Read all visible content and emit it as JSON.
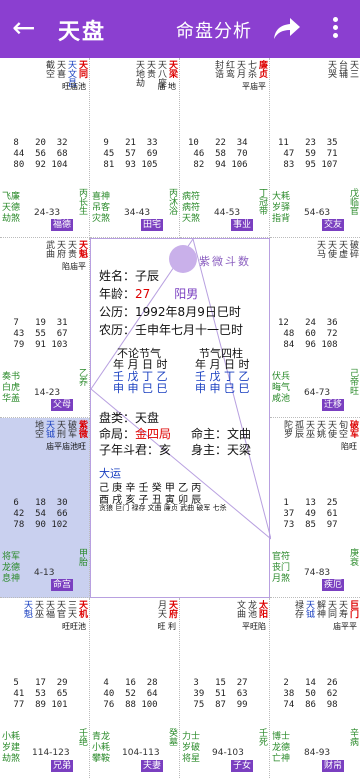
{
  "app": {
    "back": "←",
    "title": "天盘",
    "subtitle": "命盘分析"
  },
  "palaces": [
    {
      "stars": [
        "天同",
        "天文昌",
        "天喜",
        "截空"
      ],
      "main": "天同",
      "bright": "旺庙池",
      "nums": " 8   20  32\n 44  56  68\n 80  92 104",
      "l1": [
        "飞廉",
        "天德",
        "劫煞"
      ],
      "l2": [],
      "ages": "24-33",
      "gz": "丙长生",
      "palace": "福德"
    },
    {
      "stars": [
        "天梁",
        "天八座",
        "天贵",
        "天地劫"
      ],
      "main": "天梁",
      "bright": "庙 地",
      "nums": " 9   21  33\n 45  57  69\n 81  93 105",
      "l1": [
        "喜神",
        "吊客",
        "灾煞"
      ],
      "l2": [],
      "ages": "34-43",
      "gz": "丙沐浴",
      "palace": "田宅"
    },
    {
      "stars": [
        "廉贞",
        "七杀",
        "天月",
        "红鸾",
        "封诰"
      ],
      "main": "七杀",
      "bright": "平庙平",
      "nums": "10   22  34\n 46  58  70\n 82  94 106",
      "l1": [
        "病符",
        "病符",
        "天煞"
      ],
      "l2": [],
      "ages": "44-53",
      "gz": "丁冠带",
      "palace": "事业"
    },
    {
      "stars": [
        "天三",
        "台辅",
        "天哭"
      ],
      "main": "",
      "bright": "",
      "nums": "11   23  35\n 47  59  71\n 83  95 107",
      "l1": [
        "大耗",
        "岁驿",
        "指背"
      ],
      "l2": [],
      "ages": "54-63",
      "gz": "戊临官",
      "palace": "交友"
    }
  ],
  "left_mid": [
    {
      "stars": [
        "天魁",
        "天贵",
        "天府",
        "武曲"
      ],
      "bright": "陷庙平",
      "nums": " 7   19  31\n 43  55  67\n 79  91 103",
      "l1": [
        "奏书",
        "白虎",
        "华盖"
      ],
      "ages": "14-23",
      "gz": "乙养",
      "palace": "父母"
    },
    {
      "stars": [
        "破军",
        "天刑",
        "天钺",
        "地空",
        "紫微"
      ],
      "bright": "庙平庙池旺",
      "nums": " 6   18  30\n 42  54  66\n 78  90 102",
      "l1": [
        "将军",
        "龙德",
        "息神"
      ],
      "ages": "4-13",
      "gz": "甲胎",
      "palace": "命宫"
    }
  ],
  "right_mid": [
    {
      "stars": [
        "破碎",
        "天虚",
        "天使",
        "天马"
      ],
      "bright": "",
      "nums": "12   24  36\n 48  60  72\n 84  96 108",
      "l1": [
        "伏兵",
        "晦气",
        "咸池"
      ],
      "ages": "64-73",
      "gz": "己帝旺",
      "palace": "迁移"
    },
    {
      "stars": [
        "旬空",
        "天使",
        "天姚",
        "天巫",
        "孤辰",
        "破军",
        "陀罗"
      ],
      "bright": "陷旺",
      "nums": " 1   13  25\n 37  49  61\n 73  85  97",
      "l1": [
        "官符",
        "丧门",
        "月煞"
      ],
      "ages": "74-83",
      "gz": "庚衰",
      "palace": "疾厄"
    }
  ],
  "bottom": [
    {
      "stars": [
        "三天",
        "天官",
        "天福",
        "天机",
        "天巫",
        "天魁"
      ],
      "bright": "旺旺池",
      "nums": " 5   17  29\n 41  53  65\n 77  89 101",
      "l1": [
        "小耗",
        "岁建",
        "劫煞"
      ],
      "ages": "114-123",
      "gz": "壬绝",
      "palace": "兄弟"
    },
    {
      "stars": [
        "月天",
        "天府"
      ],
      "bright": "旺 利",
      "nums": " 4   16  28\n 40  52  64\n 76  88 100",
      "l1": [
        "青龙",
        "小耗",
        "攀鞍"
      ],
      "ages": "104-113",
      "gz": "癸墓",
      "palace": "夫妻"
    },
    {
      "stars": [
        "龙池",
        "文曲",
        "太阳"
      ],
      "bright": "平旺陷",
      "nums": " 3   15  27\n 39  51  63\n 75  87  99",
      "l1": [
        "力士",
        "岁破",
        "将星"
      ],
      "ages": "94-103",
      "gz": "壬死",
      "palace": "子女"
    },
    {
      "stars": [
        "天寿",
        "巨门",
        "天同",
        "解神",
        "天钺",
        "禄存"
      ],
      "bright": "庙平平",
      "nums": " 2   14  26\n 38  50  62\n 74  86  98",
      "l1": [
        "博士",
        "龙德",
        "亡神"
      ],
      "ages": "84-93",
      "gz": "辛病",
      "palace": "财帛"
    }
  ],
  "center": {
    "logo": "紫微斗数",
    "name_label": "姓名：",
    "name": "子辰",
    "age_label": "年龄：",
    "age": "27",
    "gender": "阳男",
    "solar_label": "公历：",
    "solar": "1992年8月9日巳时",
    "lunar_label": "农历：",
    "lunar": "壬申年七月十一巳时",
    "jq1": "不论节气",
    "jq2": "节气四柱",
    "pillar_head": "年 月 日 时",
    "pillar_row1": "壬 戊 丁 乙",
    "pillar_row2": "申 申 巳 巳",
    "ju_label": "盘类：",
    "ju": "天盘",
    "mingju_label": "命局：",
    "mingju": "金四局",
    "mingzhu_label": "命主：",
    "mingzhu": "文曲",
    "dou_label": "子年斗君：",
    "dou": "亥",
    "shenzhu_label": "身主：",
    "shenzhu": "天梁",
    "dayun": "大运",
    "dy_stems": "己 庚 辛 壬 癸 甲 乙 丙",
    "dy_branch": "酉 戌 亥 子 丑 寅 卯 辰",
    "dy_names": "贪狼 巨门 禄存 文曲 廉贞 武曲 破军 七杀"
  }
}
